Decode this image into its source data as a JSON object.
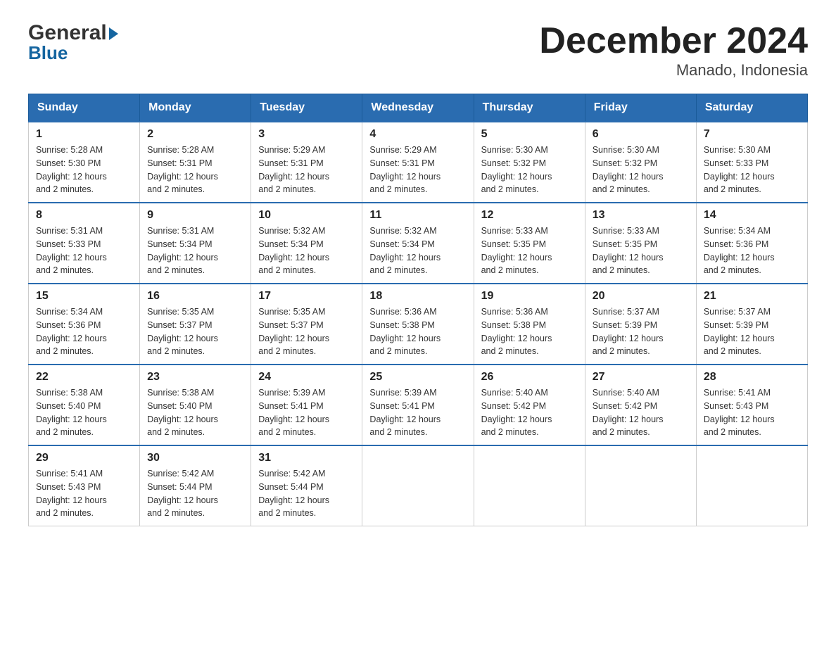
{
  "logo": {
    "general": "General",
    "blue": "Blue"
  },
  "title": "December 2024",
  "subtitle": "Manado, Indonesia",
  "days_of_week": [
    "Sunday",
    "Monday",
    "Tuesday",
    "Wednesday",
    "Thursday",
    "Friday",
    "Saturday"
  ],
  "weeks": [
    [
      {
        "day": "1",
        "sunrise": "5:28 AM",
        "sunset": "5:30 PM",
        "daylight": "12 hours and 2 minutes."
      },
      {
        "day": "2",
        "sunrise": "5:28 AM",
        "sunset": "5:31 PM",
        "daylight": "12 hours and 2 minutes."
      },
      {
        "day": "3",
        "sunrise": "5:29 AM",
        "sunset": "5:31 PM",
        "daylight": "12 hours and 2 minutes."
      },
      {
        "day": "4",
        "sunrise": "5:29 AM",
        "sunset": "5:31 PM",
        "daylight": "12 hours and 2 minutes."
      },
      {
        "day": "5",
        "sunrise": "5:30 AM",
        "sunset": "5:32 PM",
        "daylight": "12 hours and 2 minutes."
      },
      {
        "day": "6",
        "sunrise": "5:30 AM",
        "sunset": "5:32 PM",
        "daylight": "12 hours and 2 minutes."
      },
      {
        "day": "7",
        "sunrise": "5:30 AM",
        "sunset": "5:33 PM",
        "daylight": "12 hours and 2 minutes."
      }
    ],
    [
      {
        "day": "8",
        "sunrise": "5:31 AM",
        "sunset": "5:33 PM",
        "daylight": "12 hours and 2 minutes."
      },
      {
        "day": "9",
        "sunrise": "5:31 AM",
        "sunset": "5:34 PM",
        "daylight": "12 hours and 2 minutes."
      },
      {
        "day": "10",
        "sunrise": "5:32 AM",
        "sunset": "5:34 PM",
        "daylight": "12 hours and 2 minutes."
      },
      {
        "day": "11",
        "sunrise": "5:32 AM",
        "sunset": "5:34 PM",
        "daylight": "12 hours and 2 minutes."
      },
      {
        "day": "12",
        "sunrise": "5:33 AM",
        "sunset": "5:35 PM",
        "daylight": "12 hours and 2 minutes."
      },
      {
        "day": "13",
        "sunrise": "5:33 AM",
        "sunset": "5:35 PM",
        "daylight": "12 hours and 2 minutes."
      },
      {
        "day": "14",
        "sunrise": "5:34 AM",
        "sunset": "5:36 PM",
        "daylight": "12 hours and 2 minutes."
      }
    ],
    [
      {
        "day": "15",
        "sunrise": "5:34 AM",
        "sunset": "5:36 PM",
        "daylight": "12 hours and 2 minutes."
      },
      {
        "day": "16",
        "sunrise": "5:35 AM",
        "sunset": "5:37 PM",
        "daylight": "12 hours and 2 minutes."
      },
      {
        "day": "17",
        "sunrise": "5:35 AM",
        "sunset": "5:37 PM",
        "daylight": "12 hours and 2 minutes."
      },
      {
        "day": "18",
        "sunrise": "5:36 AM",
        "sunset": "5:38 PM",
        "daylight": "12 hours and 2 minutes."
      },
      {
        "day": "19",
        "sunrise": "5:36 AM",
        "sunset": "5:38 PM",
        "daylight": "12 hours and 2 minutes."
      },
      {
        "day": "20",
        "sunrise": "5:37 AM",
        "sunset": "5:39 PM",
        "daylight": "12 hours and 2 minutes."
      },
      {
        "day": "21",
        "sunrise": "5:37 AM",
        "sunset": "5:39 PM",
        "daylight": "12 hours and 2 minutes."
      }
    ],
    [
      {
        "day": "22",
        "sunrise": "5:38 AM",
        "sunset": "5:40 PM",
        "daylight": "12 hours and 2 minutes."
      },
      {
        "day": "23",
        "sunrise": "5:38 AM",
        "sunset": "5:40 PM",
        "daylight": "12 hours and 2 minutes."
      },
      {
        "day": "24",
        "sunrise": "5:39 AM",
        "sunset": "5:41 PM",
        "daylight": "12 hours and 2 minutes."
      },
      {
        "day": "25",
        "sunrise": "5:39 AM",
        "sunset": "5:41 PM",
        "daylight": "12 hours and 2 minutes."
      },
      {
        "day": "26",
        "sunrise": "5:40 AM",
        "sunset": "5:42 PM",
        "daylight": "12 hours and 2 minutes."
      },
      {
        "day": "27",
        "sunrise": "5:40 AM",
        "sunset": "5:42 PM",
        "daylight": "12 hours and 2 minutes."
      },
      {
        "day": "28",
        "sunrise": "5:41 AM",
        "sunset": "5:43 PM",
        "daylight": "12 hours and 2 minutes."
      }
    ],
    [
      {
        "day": "29",
        "sunrise": "5:41 AM",
        "sunset": "5:43 PM",
        "daylight": "12 hours and 2 minutes."
      },
      {
        "day": "30",
        "sunrise": "5:42 AM",
        "sunset": "5:44 PM",
        "daylight": "12 hours and 2 minutes."
      },
      {
        "day": "31",
        "sunrise": "5:42 AM",
        "sunset": "5:44 PM",
        "daylight": "12 hours and 2 minutes."
      },
      null,
      null,
      null,
      null
    ]
  ],
  "labels": {
    "sunrise": "Sunrise:",
    "sunset": "Sunset:",
    "daylight": "Daylight:"
  }
}
